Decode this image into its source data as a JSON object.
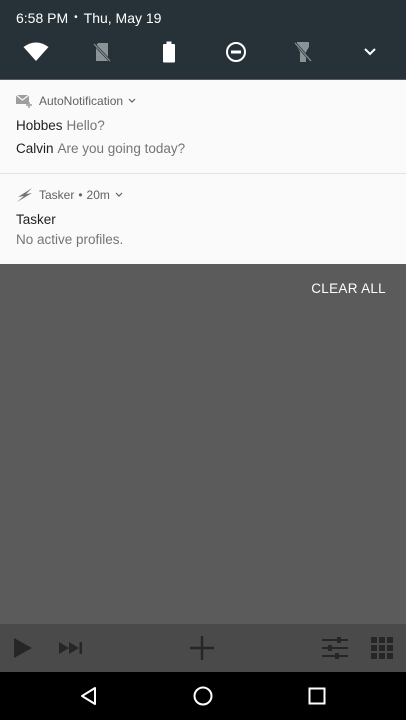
{
  "status_bar": {
    "time": "6:58 PM",
    "separator": "•",
    "date": "Thu, May 19"
  },
  "quick_settings": [
    {
      "icon": "wifi-icon"
    },
    {
      "icon": "no-sim-icon"
    },
    {
      "icon": "battery-icon"
    },
    {
      "icon": "do-not-disturb-icon"
    },
    {
      "icon": "flashlight-off-icon"
    },
    {
      "icon": "expand-chevron-icon"
    }
  ],
  "notifications": [
    {
      "app": "AutoNotification",
      "icon": "email-icon",
      "messages": [
        {
          "sender": "Hobbes",
          "text": "Hello?"
        },
        {
          "sender": "Calvin",
          "text": "Are you going today?"
        }
      ]
    },
    {
      "app": "Tasker",
      "time": "20m",
      "dot": "•",
      "icon": "tasker-bolt-icon",
      "title": "Tasker",
      "body": "No active profiles."
    }
  ],
  "clear_all_label": "CLEAR ALL",
  "app_toolbar": [
    "play-icon",
    "skip-next-icon",
    "add-icon",
    "sliders-icon",
    "grid-icon"
  ],
  "nav": [
    "back-icon",
    "home-icon",
    "recents-icon"
  ],
  "colors": {
    "header_bg": "#263238",
    "card_bg": "#fafafa",
    "scrim": "#5b5b5b"
  }
}
